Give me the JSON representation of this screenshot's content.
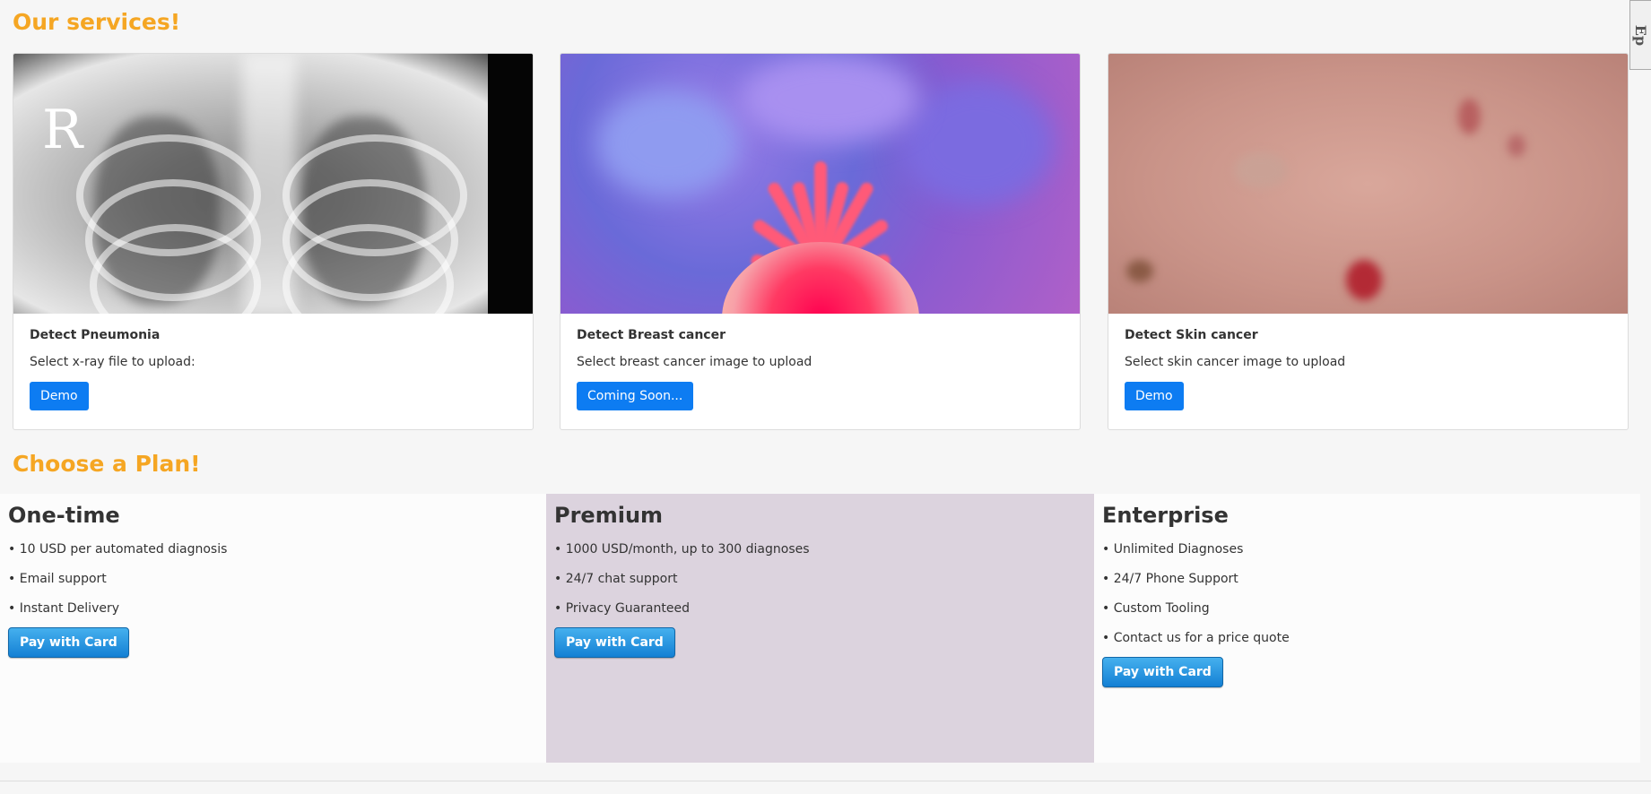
{
  "services": {
    "title": "Our services!",
    "cards": [
      {
        "title": "Detect Pneumonia",
        "text": "Select x-ray file to upload:",
        "button": "Demo",
        "image": "chest-xray"
      },
      {
        "title": "Detect Breast cancer",
        "text": "Select breast cancer image to upload",
        "button": "Coming Soon...",
        "image": "cancer-cell"
      },
      {
        "title": "Detect Skin cancer",
        "text": "Select skin cancer image to upload",
        "button": "Demo",
        "image": "skin-lesion"
      }
    ]
  },
  "plans": {
    "title": "Choose a Plan!",
    "items": [
      {
        "name": "One-time",
        "features": [
          "10 USD per automated diagnosis",
          "Email support",
          "Instant Delivery"
        ],
        "button": "Pay with Card",
        "background": "#fcfcfc"
      },
      {
        "name": "Premium",
        "features": [
          "1000 USD/month, up to 300 diagnoses",
          "24/7 chat support",
          "Privacy Guaranteed"
        ],
        "button": "Pay with Card",
        "background": "#dcd3de"
      },
      {
        "name": "Enterprise",
        "features": [
          "Unlimited Diagnoses",
          "24/7 Phone Support",
          "Custom Tooling",
          "Contact us for a price quote"
        ],
        "button": "Pay with Card",
        "background": "#fcfcfc"
      }
    ]
  },
  "colors": {
    "accent_heading": "#f5a623",
    "primary_button": "#0d7cf2",
    "page_background": "#f6f6f6"
  },
  "side_tab": {
    "icon": "feedback-tab-icon"
  }
}
